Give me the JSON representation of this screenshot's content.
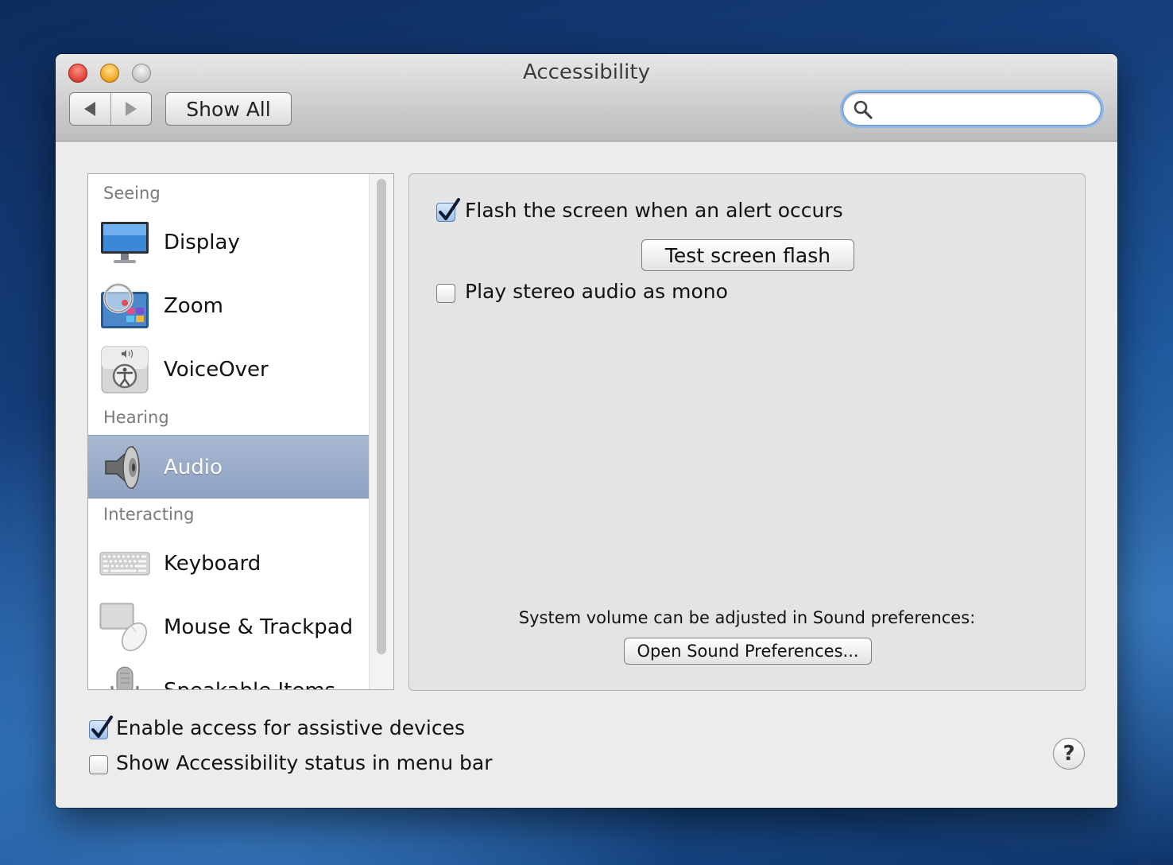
{
  "window": {
    "title": "Accessibility",
    "toolbar": {
      "show_all_label": "Show All"
    },
    "search": {
      "value": "",
      "placeholder": ""
    }
  },
  "sidebar": {
    "sections": [
      {
        "heading": "Seeing",
        "items": [
          {
            "label": "Display",
            "icon": "display-icon"
          },
          {
            "label": "Zoom",
            "icon": "zoom-icon"
          },
          {
            "label": "VoiceOver",
            "icon": "voiceover-icon"
          }
        ]
      },
      {
        "heading": "Hearing",
        "items": [
          {
            "label": "Audio",
            "icon": "speaker-icon",
            "selected": true
          }
        ]
      },
      {
        "heading": "Interacting",
        "items": [
          {
            "label": "Keyboard",
            "icon": "keyboard-icon"
          },
          {
            "label": "Mouse & Trackpad",
            "icon": "mouse-icon"
          },
          {
            "label": "Speakable Items",
            "icon": "microphone-icon"
          }
        ]
      }
    ]
  },
  "audio_panel": {
    "flash_screen": {
      "label": "Flash the screen when an alert occurs",
      "checked": true
    },
    "test_flash_label": "Test screen flash",
    "mono_audio": {
      "label": "Play stereo audio as mono",
      "checked": false
    },
    "volume_note": "System volume can be adjusted in Sound preferences:",
    "open_sound_label": "Open Sound Preferences..."
  },
  "footer": {
    "assistive_devices": {
      "label": "Enable access for assistive devices",
      "checked": true
    },
    "menu_bar_status": {
      "label": "Show Accessibility status in menu bar",
      "checked": false
    },
    "help_label": "?"
  },
  "colors": {
    "selection": "#98a9c8",
    "search_focus_ring": "#8cb8ea",
    "close": "#e0443a",
    "minimize": "#f1a928"
  }
}
